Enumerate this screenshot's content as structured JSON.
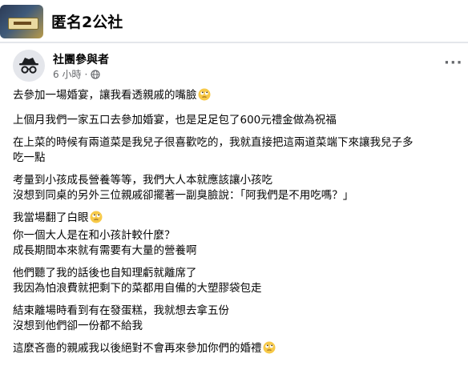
{
  "header": {
    "group_name": "匿名2公社"
  },
  "post": {
    "author": "社團參與者",
    "time": "6 小時",
    "more_label": "···",
    "paragraphs": [
      {
        "lines": [
          "去參加一場婚宴，讓我看透親戚的嘴臉"
        ],
        "emoji": "rolling-eyes"
      },
      {
        "lines": [
          "上個月我們一家五口去參加婚宴，也是足足包了600元禮金做為祝福"
        ]
      },
      {
        "lines": [
          "在上菜的時候有兩道菜是我兒子很喜歡吃的，我就直接把這兩道菜端下來讓我兒子多",
          "吃一點"
        ]
      },
      {
        "lines": [
          "考量到小孩成長營養等等，我們大人本就應該讓小孩吃",
          "沒想到同桌的另外三位親戚卻擺著一副臭臉說：「阿我們是不用吃嗎？」"
        ]
      },
      {
        "lines": [
          "我當場翻了白眼",
          "你一個大人是在和小孩計較什麼？",
          "成長期間本來就有需要有大量的營養啊"
        ],
        "emoji_after_line": 0
      },
      {
        "lines": [
          "他們聽了我的話後也自知理虧就離席了",
          "我因為怕浪費就把剩下的菜都用自備的大塑膠袋包走"
        ]
      },
      {
        "lines": [
          "結束離場時看到有在發蛋糕，我就想去拿五份",
          "沒想到他們卻一份都不給我"
        ]
      },
      {
        "lines": [
          "這麼吝嗇的親戚我以後絕對不會再來參加你們的婚禮"
        ],
        "emoji": "rolling-eyes"
      }
    ]
  }
}
